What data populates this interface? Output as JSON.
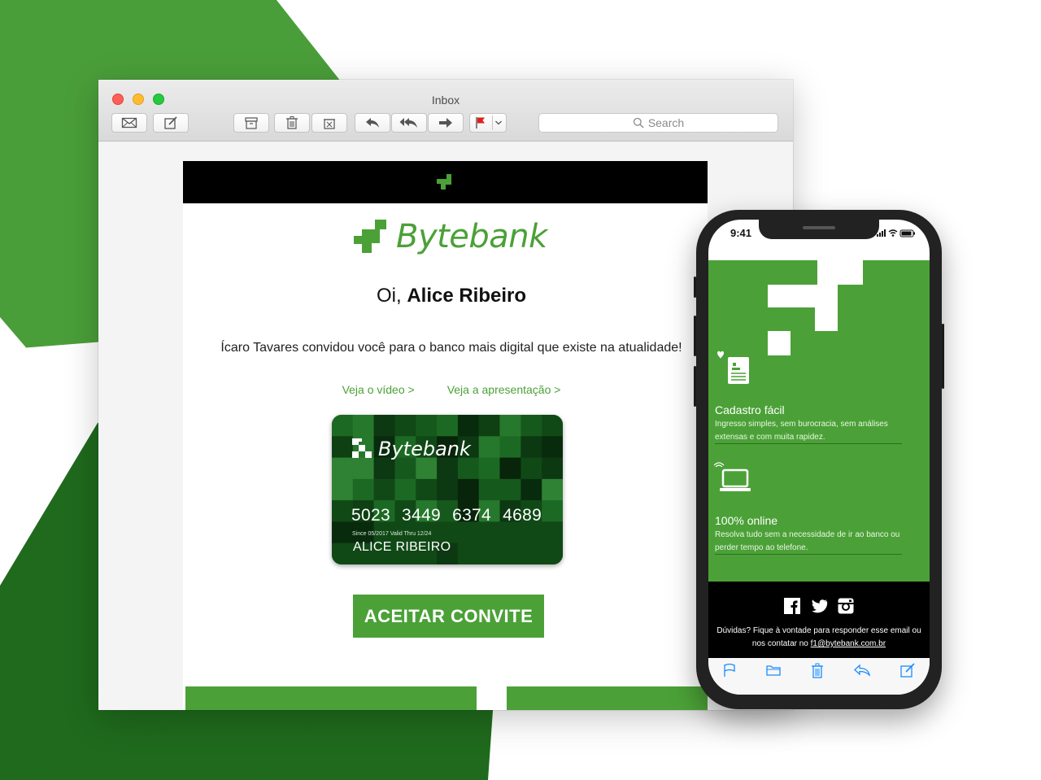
{
  "colors": {
    "brand_green": "#4ba137",
    "dark_green": "#1a6b1a",
    "black": "#000000"
  },
  "window": {
    "title": "Inbox",
    "toolbar": {
      "buttons": [
        "envelope-icon",
        "compose-icon",
        "archive-icon",
        "trash-icon",
        "junk-icon",
        "reply-icon",
        "reply-all-icon",
        "forward-icon",
        "flag-icon",
        "chevron-down-icon"
      ]
    },
    "search": {
      "placeholder": "Search"
    }
  },
  "email": {
    "brand": "Bytebank",
    "greeting_prefix": "Oi, ",
    "greeting_name": "Alice Ribeiro",
    "invite_text": "Ícaro Tavares convidou você para o banco mais digital que existe na atualidade!",
    "link_video": "Veja o vídeo >",
    "link_presentation": "Veja a apresentação >",
    "card": {
      "brand": "Bytebank",
      "number": "5023 3449 6374 4689",
      "validity": "Since 05/2017  Valid Thru 12/24",
      "holder": "ALICE RIBEIRO"
    },
    "cta": "ACEITAR CONVITE"
  },
  "phone": {
    "time": "9:41",
    "features": [
      {
        "icon": "document-heart-icon",
        "title": "Cadastro fácil",
        "desc": "Ingresso simples, sem burocracia, sem análises extensas e com muita rapidez."
      },
      {
        "icon": "laptop-wifi-icon",
        "title": "100% online",
        "desc": "Resolva tudo sem a necessidade de ir ao banco ou perder tempo ao telefone."
      }
    ],
    "social": [
      "facebook-icon",
      "twitter-icon",
      "instagram-icon"
    ],
    "help_text": "Dúvidas? Fique à vontade para responder esse email ou nos contatar no ",
    "help_email": "f1@bytebank.com.br",
    "toolbar": [
      "flag-icon",
      "folder-icon",
      "trash-icon",
      "reply-icon",
      "compose-icon"
    ]
  }
}
